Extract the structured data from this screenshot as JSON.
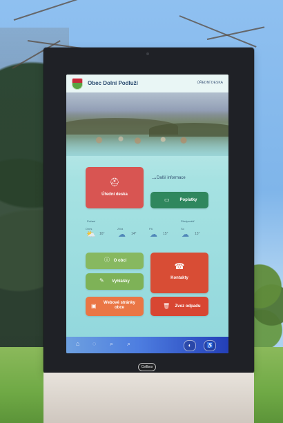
{
  "screen": {
    "title": "Obec Dolní Podluží",
    "header_link": "ÚŘEDNÍ DESKA",
    "more_info": "Další informace",
    "tiles": {
      "official_board": "Úřední deska",
      "fees": "Poplatky",
      "about_municipality": "O obci",
      "public_notices": "Vyhlášky",
      "contacts": "Kontakty",
      "municipal_website": "Webové stránky obce",
      "waste_collection": "Zvoz odpadu"
    },
    "weather": {
      "title": "Počasí",
      "more": "Předpověď",
      "days": [
        {
          "label": "Dnes",
          "icon": "sun-cloud",
          "temp": "16°"
        },
        {
          "label": "Zítra",
          "icon": "cloud",
          "temp": "14°"
        },
        {
          "label": "Pá",
          "icon": "cloud",
          "temp": "15°"
        },
        {
          "label": "So",
          "icon": "cloud",
          "temp": "13°"
        }
      ]
    },
    "bottom_nav": {
      "home_icon": "home-icon",
      "user_icon": "user-icon",
      "search_icon": "search-icon",
      "zoom_icon": "zoom-icon",
      "dark_mode": "◐",
      "accessibility": "♿"
    }
  },
  "device": {
    "brand": "Cellbox"
  }
}
